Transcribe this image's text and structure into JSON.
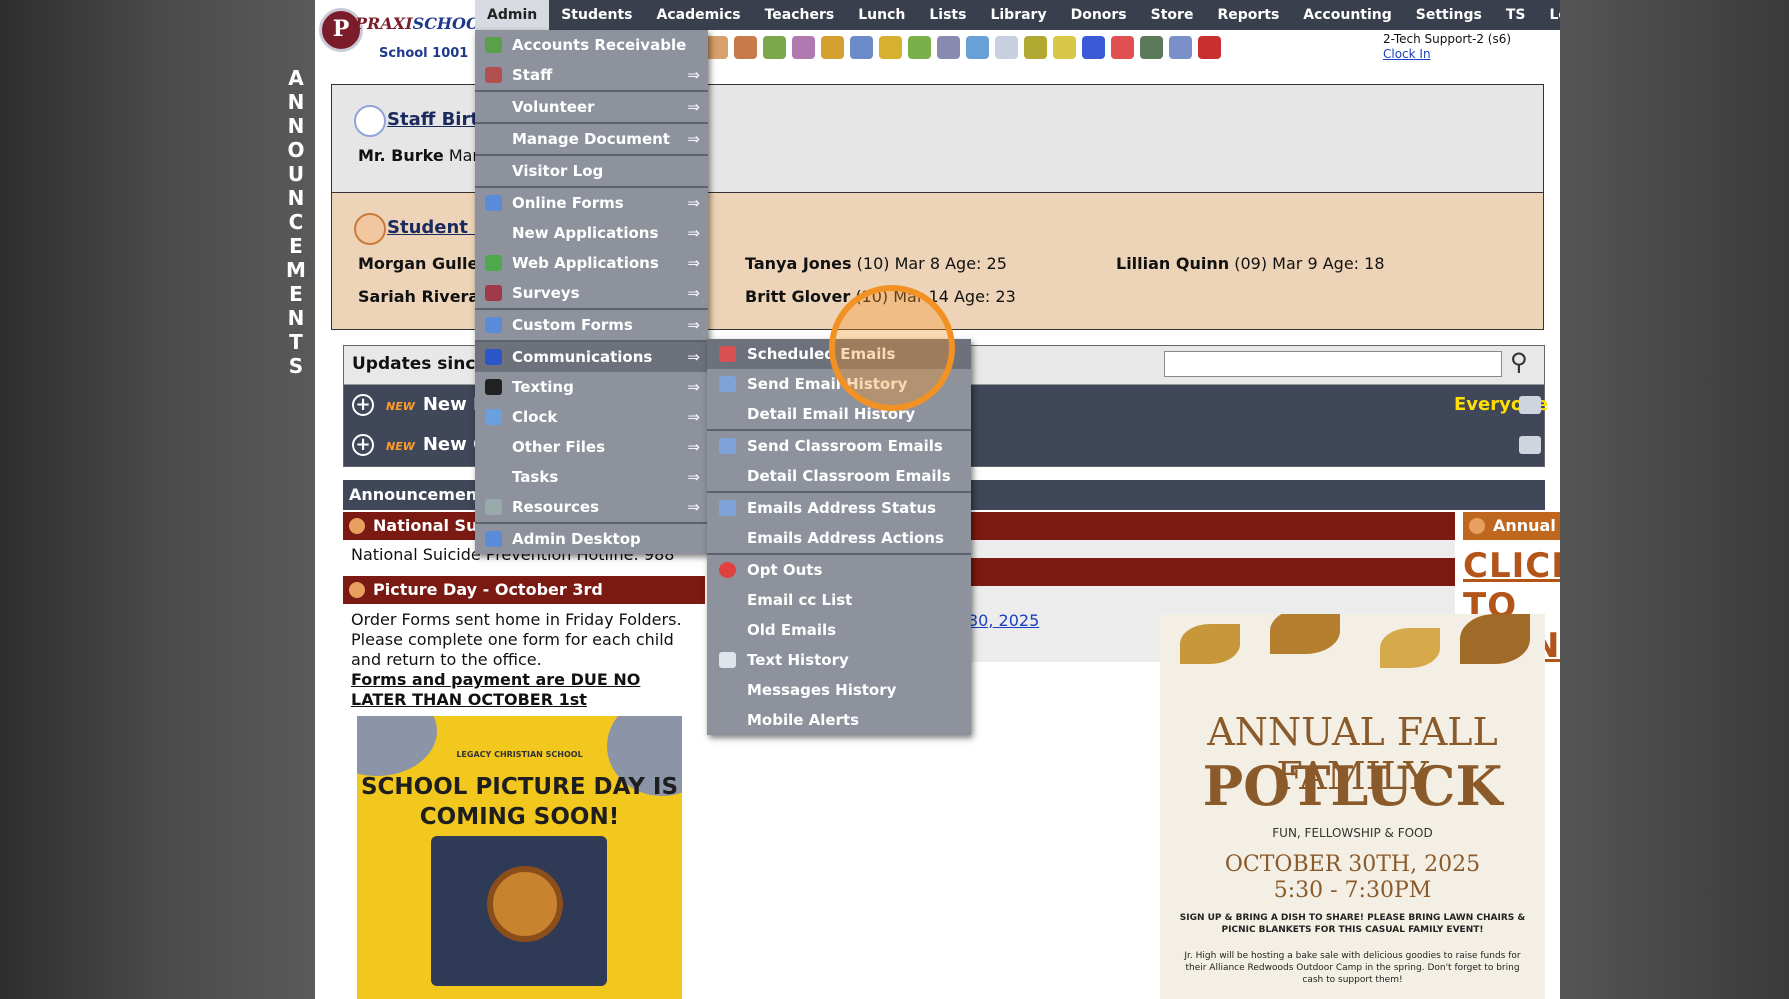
{
  "logo": {
    "letter": "P",
    "name_a": "PRAXI",
    "name_b": "SCHOOL",
    "school": "School 1001"
  },
  "nav": [
    "Admin",
    "Students",
    "Academics",
    "Teachers",
    "Lunch",
    "Lists",
    "Library",
    "Donors",
    "Store",
    "Reports",
    "Accounting",
    "Settings",
    "TS",
    "Logout"
  ],
  "user": {
    "name": "2-Tech Support-2 (s6)",
    "clock": "Clock In"
  },
  "announcements_letters": [
    "A",
    "N",
    "N",
    "O",
    "U",
    "N",
    "C",
    "E",
    "M",
    "E",
    "N",
    "T",
    "S"
  ],
  "birthdays": {
    "staff_title": "Staff Birt",
    "staff_entry_name": "Mr. Burke",
    "staff_entry_rest": "Mar",
    "student_title": "Student B",
    "students": [
      {
        "name": "Morgan Gulle",
        "rest": ""
      },
      {
        "name": "Sariah Rivera",
        "rest": ""
      },
      {
        "name": "Tanya Jones",
        "rest": "(10) Mar 8 Age: 25"
      },
      {
        "name": "Britt Glover",
        "rest": "(10) Mar 14 Age: 23"
      },
      {
        "name": "Lillian Quinn",
        "rest": "(09) Mar 9 Age: 18"
      }
    ]
  },
  "updates": {
    "label": "Updates since:",
    "search_placeholder": "",
    "row1": "New E",
    "row2": "New C",
    "badge": "NEW",
    "audience": "Everyone"
  },
  "announcements": {
    "bar": "Announcements",
    "col1_head1": "National Suic",
    "col1_text1": "National Suicide Prevention Hotline: 988",
    "col1_head2": "Picture Day - October 3rd",
    "col1_text2": "Order Forms sent home in Friday Folders. Please complete one form for each child and return to the office.",
    "col1_text3": "Forms and payment are DUE NO LATER THAN OCTOBER 1st",
    "col2_link": "30, 2025",
    "col3_head": "Annual Fall Family Potluck",
    "col3_signup": "CLICK TO SIGN UP"
  },
  "picture_poster": {
    "school": "LEGACY CHRISTIAN SCHOOL",
    "line1": "SCHOOL PICTURE DAY IS",
    "line2": "COMING SOON!"
  },
  "potluck_poster": {
    "title1": "ANNUAL FALL FAMILY",
    "title2": "POTLUCK",
    "sub": "FUN, FELLOWSHIP & FOOD",
    "date": "OCTOBER 30TH, 2025",
    "time": "5:30 - 7:30PM",
    "note1": "SIGN UP & BRING A DISH TO SHARE! PLEASE BRING LAWN CHAIRS & PICNIC BLANKETS FOR THIS CASUAL FAMILY EVENT!",
    "note2": "Jr. High will be hosting a bake sale with delicious goodies to raise funds for their Alliance Redwoods Outdoor Camp in the spring. Don't forget to bring cash to support them!"
  },
  "admin_menu": [
    {
      "label": "Accounts Receivable",
      "arrow": "",
      "icon": "money-icon",
      "color": "#5aa04a"
    },
    {
      "label": "Staff",
      "arrow": "⇒",
      "icon": "staff-icon",
      "color": "#b05050"
    },
    {
      "label": "Volunteer",
      "arrow": "⇒",
      "icon": "",
      "color": ""
    },
    {
      "label": "Manage Document",
      "arrow": "⇒",
      "icon": "",
      "color": ""
    },
    {
      "label": "Visitor Log",
      "arrow": "",
      "icon": "",
      "color": ""
    },
    {
      "label": "Online Forms",
      "arrow": "⇒",
      "icon": "form-icon",
      "color": "#5b8bd8"
    },
    {
      "label": "New Applications",
      "arrow": "⇒",
      "icon": "",
      "color": ""
    },
    {
      "label": "Web Applications",
      "arrow": "⇒",
      "icon": "globe-icon",
      "color": "#4ea84e"
    },
    {
      "label": "Surveys",
      "arrow": "⇒",
      "icon": "survey-icon",
      "color": "#a03a4a"
    },
    {
      "label": "Custom Forms",
      "arrow": "⇒",
      "icon": "form-icon",
      "color": "#5b8bd8"
    },
    {
      "label": "Communications",
      "arrow": "⇒",
      "icon": "at-icon",
      "color": "#2b55c8"
    },
    {
      "label": "Texting",
      "arrow": "⇒",
      "icon": "phone-icon",
      "color": "#222"
    },
    {
      "label": "Clock",
      "arrow": "⇒",
      "icon": "clock-icon",
      "color": "#6aa0e0"
    },
    {
      "label": "Other Files",
      "arrow": "⇒",
      "icon": "",
      "color": ""
    },
    {
      "label": "Tasks",
      "arrow": "⇒",
      "icon": "",
      "color": ""
    },
    {
      "label": "Resources",
      "arrow": "⇒",
      "icon": "resources-icon",
      "color": "#9aa"
    },
    {
      "label": "Admin Desktop",
      "arrow": "",
      "icon": "desktop-icon",
      "color": "#5b8bd8"
    }
  ],
  "comm_menu": [
    {
      "label": "Scheduled Emails",
      "icon": "calendar-icon",
      "color": "#d85050"
    },
    {
      "label": "Send Email History",
      "icon": "envelope-icon",
      "color": "#7fa3d8"
    },
    {
      "label": "Detail Email History",
      "icon": "",
      "color": ""
    },
    {
      "label": "Send Classroom Emails",
      "icon": "envelope-icon",
      "color": "#7fa3d8"
    },
    {
      "label": "Detail Classroom Emails",
      "icon": "",
      "color": ""
    },
    {
      "label": "Emails Address Status",
      "icon": "envelope-icon",
      "color": "#7fa3d8"
    },
    {
      "label": "Emails Address Actions",
      "icon": "",
      "color": ""
    },
    {
      "label": "Opt Outs",
      "icon": "close-circle-icon",
      "color": "#e04040"
    },
    {
      "label": "Email cc List",
      "icon": "",
      "color": ""
    },
    {
      "label": "Old Emails",
      "icon": "",
      "color": ""
    },
    {
      "label": "Text History",
      "icon": "phone-icon",
      "color": "#dfe3ea"
    },
    {
      "label": "Messages History",
      "icon": "",
      "color": ""
    },
    {
      "label": "Mobile Alerts",
      "icon": "",
      "color": ""
    }
  ]
}
